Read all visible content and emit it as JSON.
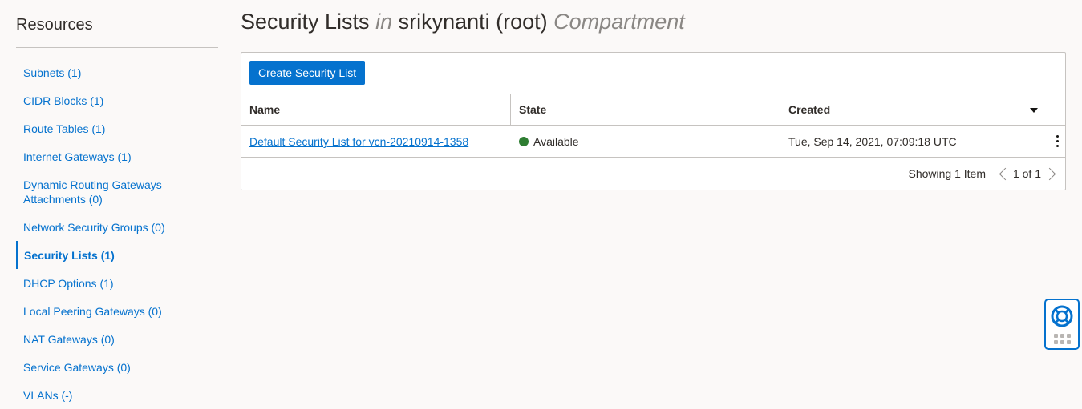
{
  "sidebar": {
    "title": "Resources",
    "items": [
      {
        "label": "Subnets (1)"
      },
      {
        "label": "CIDR Blocks (1)"
      },
      {
        "label": "Route Tables (1)"
      },
      {
        "label": "Internet Gateways (1)"
      },
      {
        "label": "Dynamic Routing Gateways Attachments (0)"
      },
      {
        "label": "Network Security Groups (0)"
      },
      {
        "label": "Security Lists (1)",
        "active": true
      },
      {
        "label": "DHCP Options (1)"
      },
      {
        "label": "Local Peering Gateways (0)"
      },
      {
        "label": "NAT Gateways (0)"
      },
      {
        "label": "Service Gateways (0)"
      },
      {
        "label": "VLANs (-)"
      }
    ]
  },
  "header": {
    "title_main": "Security Lists",
    "title_in": "in",
    "title_compartment_name": "srikynanti (root)",
    "title_compartment_word": "Compartment"
  },
  "toolbar": {
    "create_label": "Create Security List"
  },
  "table": {
    "columns": [
      "Name",
      "State",
      "Created"
    ],
    "rows": [
      {
        "name": "Default Security List for vcn-20210914-1358",
        "state": "Available",
        "created": "Tue, Sep 14, 2021, 07:09:18 UTC"
      }
    ]
  },
  "pagination": {
    "showing": "Showing 1 Item",
    "page": "1 of 1"
  },
  "colors": {
    "accent": "#0572ce",
    "available": "#2e7d32",
    "background": "#fbf9f8"
  },
  "icons": {
    "sort": "caret-down-icon",
    "row_menu": "kebab-menu-icon",
    "prev": "chevron-left-icon",
    "next": "chevron-right-icon",
    "help": "lifebuoy-icon",
    "apps": "grid-icon"
  }
}
